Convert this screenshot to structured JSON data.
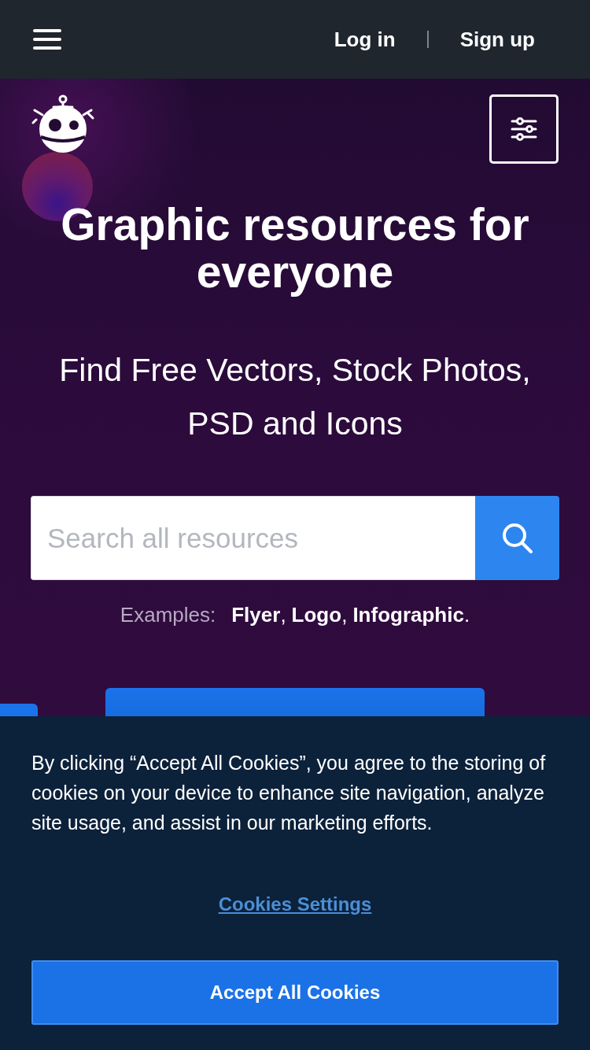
{
  "header": {
    "links": [
      "Log in",
      "Sign up"
    ]
  },
  "hero": {
    "title": "Graphic resources for everyone",
    "subtitle": "Find Free Vectors, Stock Photos, PSD and Icons",
    "search": {
      "placeholder": "Search all resources"
    },
    "examples": {
      "label": "Examples:",
      "items": [
        {
          "label": "Flyer",
          "suffix": ","
        },
        {
          "label": "Logo",
          "suffix": ","
        },
        {
          "label": "Infographic",
          "suffix": "."
        }
      ]
    }
  },
  "cookie_banner": {
    "message": "By clicking “Accept All Cookies”, you agree to the storing of cookies on your device to enhance site navigation, analyze site usage, and assist in our marketing efforts.",
    "settings_link": "Cookies Settings",
    "accept_button": "Accept All Cookies"
  }
}
